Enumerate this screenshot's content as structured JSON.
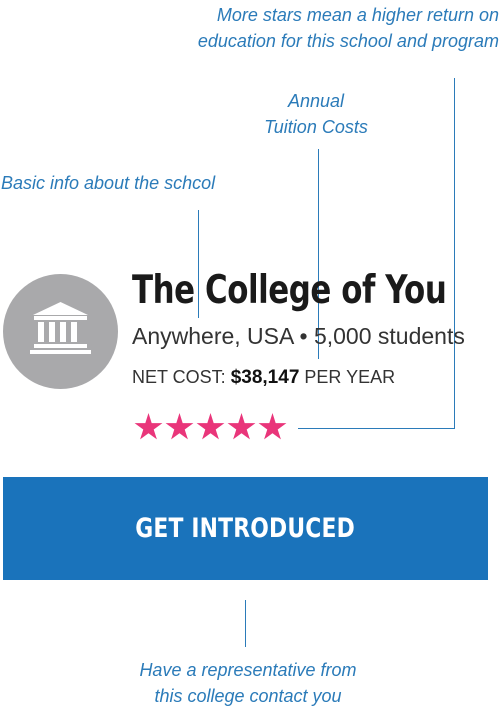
{
  "annotations": {
    "stars_note": [
      "More stars mean a higher return on",
      "education for this school and program"
    ],
    "tuition_note": [
      "Annual",
      "Tuition Costs"
    ],
    "basic_note": "Basic info about the schcol",
    "contact_note": [
      "Have a representative from",
      "this college contact you"
    ]
  },
  "school": {
    "icon": "university-building-icon",
    "name": "The College of You",
    "location": "Anywhere, USA",
    "separator": "•",
    "students": "5,000 students",
    "net_cost_label": "NET COST:",
    "net_cost_value": "$38,147",
    "net_cost_suffix": "PER YEAR",
    "rating": 5,
    "rating_max": 5
  },
  "cta": {
    "label": "GET INTRODUCED"
  },
  "colors": {
    "annotation": "#2b7bb9",
    "button": "#1a73bb",
    "star": "#e9357a",
    "icon_circle": "#a9a9ab"
  }
}
